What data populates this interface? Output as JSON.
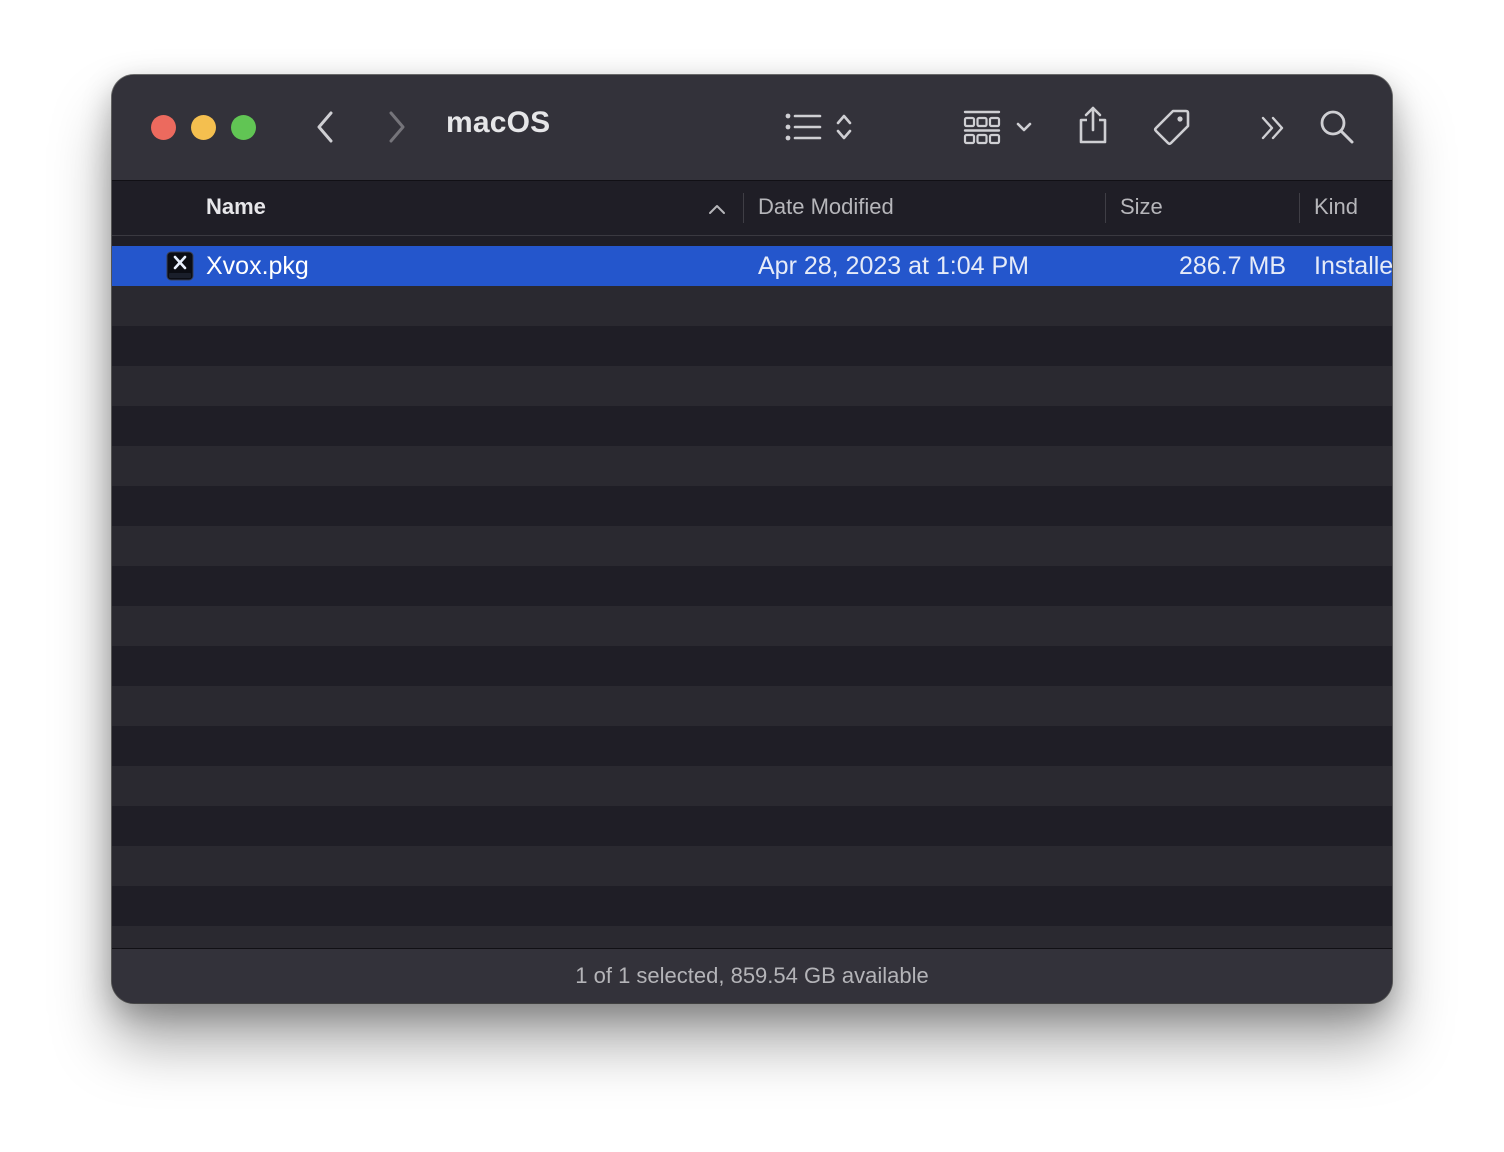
{
  "window": {
    "title": "macOS"
  },
  "toolbar": {
    "icons": [
      "back-chevron-icon",
      "forward-chevron-icon",
      "list-view-icon",
      "sort-updown-icon",
      "grid-group-icon",
      "chevron-down-icon",
      "share-icon",
      "tag-icon",
      "more-chevrons-icon",
      "search-icon"
    ]
  },
  "columns": {
    "name": "Name",
    "date": "Date Modified",
    "size": "Size",
    "kind": "Kind"
  },
  "files": [
    {
      "name": "Xvox.pkg",
      "date": "Apr 28, 2023 at 1:04 PM",
      "size": "286.7 MB",
      "kind": "Installer package",
      "selected": true
    }
  ],
  "status": {
    "text": "1 of 1 selected, 859.54 GB available"
  },
  "colors": {
    "selection": "#2456cc",
    "close": "#ec6a5e",
    "minimize": "#f4bf4f",
    "maximize": "#61c554"
  }
}
